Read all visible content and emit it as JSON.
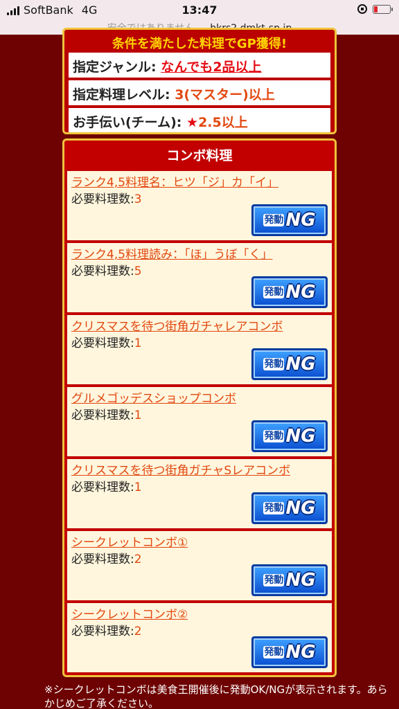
{
  "status_bar": {
    "carrier": "SoftBank",
    "network": "4G",
    "time": "13:47"
  },
  "url_bar": {
    "security": "安全ではありません —",
    "host": "bkrs2.dmkt-sp.jp"
  },
  "conditions": {
    "heading": "条件を満たした料理でGP獲得!",
    "rows": [
      {
        "label": "指定ジャンル: ",
        "value": "なんでも2品以上"
      },
      {
        "label": "指定料理レベル: ",
        "value": "3(マスター)以上"
      },
      {
        "label": "お手伝い(チーム): ",
        "star": "★",
        "value": "2.5以上"
      }
    ]
  },
  "combo": {
    "title": "コンボ料理",
    "count_label": "必要料理数:",
    "badge_prefix": "発動",
    "badge_status": "NG",
    "items": [
      {
        "name": "ランク4,5料理名：ヒツ「ジ」カ「イ」",
        "count": "3"
      },
      {
        "name": "ランク4,5料理読み：「ほ」うぼ「く」",
        "count": "5"
      },
      {
        "name": "クリスマスを待つ街角ガチャレアコンボ",
        "count": "1"
      },
      {
        "name": "グルメゴッデスショップコンボ",
        "count": "1"
      },
      {
        "name": "クリスマスを待つ街角ガチャSレアコンボ",
        "count": "1"
      },
      {
        "name": "シークレットコンボ①",
        "count": "2"
      },
      {
        "name": "シークレットコンボ②",
        "count": "2"
      }
    ]
  },
  "footnote": "※シークレットコンボは美食王開催後に発動OK/NGが表示されます。あらかじめご了承ください。"
}
